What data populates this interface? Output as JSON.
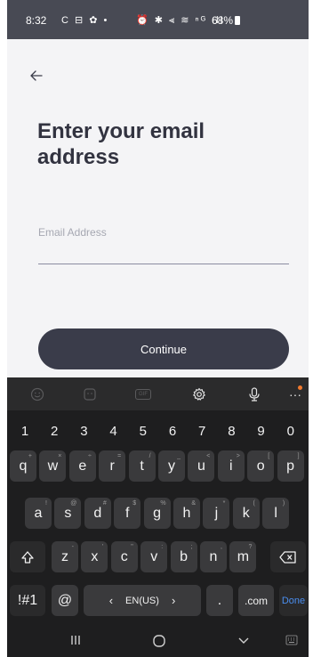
{
  "status_bar": {
    "time": "8:32",
    "left_icons": "C ⊟ ✿ •",
    "right_icons": "⏰ ✱ ⫷ ≋ ⁿᴳ ıll",
    "battery": "68%"
  },
  "page": {
    "heading": "Enter your email address",
    "email_placeholder": "Email Address",
    "email_value": "",
    "continue_label": "Continue"
  },
  "keyboard": {
    "toolbar": [
      "emoji-icon",
      "sticker-icon",
      "gif-icon",
      "settings-icon",
      "mic-icon",
      "more-icon"
    ],
    "gif_label": "GIF",
    "numbers": [
      "1",
      "2",
      "3",
      "4",
      "5",
      "6",
      "7",
      "8",
      "9",
      "0"
    ],
    "row1": [
      {
        "key": "q",
        "sub": "+"
      },
      {
        "key": "w",
        "sub": "×"
      },
      {
        "key": "e",
        "sub": "÷"
      },
      {
        "key": "r",
        "sub": "="
      },
      {
        "key": "t",
        "sub": "/"
      },
      {
        "key": "y",
        "sub": "_"
      },
      {
        "key": "u",
        "sub": "<"
      },
      {
        "key": "i",
        "sub": ">"
      },
      {
        "key": "o",
        "sub": "["
      },
      {
        "key": "p",
        "sub": "]"
      }
    ],
    "row2": [
      {
        "key": "a",
        "sub": "!"
      },
      {
        "key": "s",
        "sub": "@"
      },
      {
        "key": "d",
        "sub": "#"
      },
      {
        "key": "f",
        "sub": "$"
      },
      {
        "key": "g",
        "sub": "%"
      },
      {
        "key": "h",
        "sub": "&"
      },
      {
        "key": "j",
        "sub": "*"
      },
      {
        "key": "k",
        "sub": "("
      },
      {
        "key": "l",
        "sub": ")"
      }
    ],
    "row3": [
      {
        "key": "z",
        "sub": "-"
      },
      {
        "key": "x",
        "sub": "'"
      },
      {
        "key": "c",
        "sub": "\""
      },
      {
        "key": "v",
        "sub": ":"
      },
      {
        "key": "b",
        "sub": ";"
      },
      {
        "key": "n",
        "sub": ","
      },
      {
        "key": "m",
        "sub": "?"
      }
    ],
    "symbols_label": "!#1",
    "at_label": "@",
    "language_label": "EN(US)",
    "period_label": ".",
    "dotcom_label": ".com",
    "done_label": "Done"
  },
  "colors": {
    "status_bar_bg": "#484a54",
    "screen_bg": "#f4f4f6",
    "heading": "#323340",
    "button_bg": "#3a3c4a",
    "keyboard_bg": "#1e1e1f",
    "key_bg": "#3a3a3c",
    "done_accent": "#4a8ef0"
  }
}
